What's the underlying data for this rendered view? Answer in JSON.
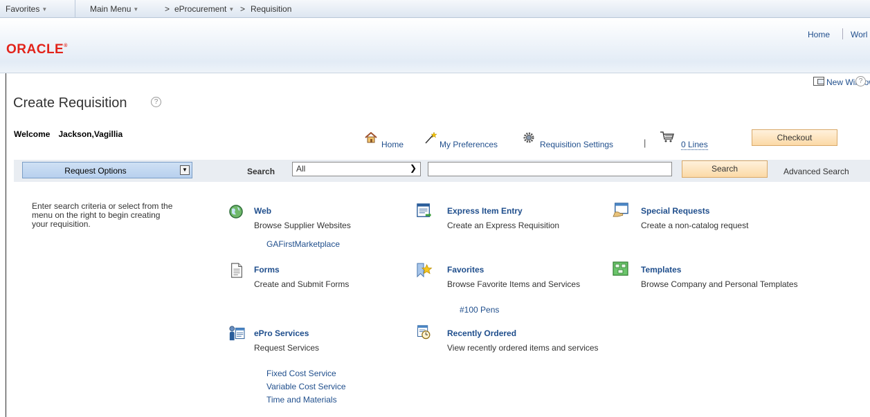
{
  "topnav": {
    "favorites": "Favorites",
    "main_menu": "Main Menu",
    "eprocurement": "eProcurement",
    "requisition": "Requisition",
    "breadcrumb_sep": ">"
  },
  "banner": {
    "logo": "ORACLE",
    "home": "Home",
    "worklist": "Worl"
  },
  "page": {
    "new_window": "New Window",
    "help": "?",
    "title": "Create Requisition",
    "welcome_label": "Welcome",
    "user_name": "Jackson,Vagillia"
  },
  "actions": {
    "home": "Home",
    "my_preferences": "My Preferences",
    "requisition_settings": "Requisition Settings",
    "pipe": "|",
    "lines": "0 Lines",
    "checkout": "Checkout"
  },
  "search": {
    "request_options": "Request Options",
    "label": "Search",
    "category_selected": "All",
    "input_value": "",
    "button": "Search",
    "advanced": "Advanced Search"
  },
  "instructions": "Enter search criteria or select from the menu on the right to begin creating your requisition.",
  "options": {
    "web": {
      "title": "Web",
      "desc": "Browse Supplier Websites",
      "links": [
        "GAFirstMarketplace"
      ]
    },
    "express": {
      "title": "Express Item Entry",
      "desc": "Create an Express Requisition"
    },
    "special": {
      "title": "Special Requests",
      "desc": "Create a non-catalog request"
    },
    "forms": {
      "title": "Forms",
      "desc": "Create and Submit Forms"
    },
    "favorites": {
      "title": "Favorites",
      "desc": "Browse Favorite Items and Services",
      "links": [
        "#100 Pens"
      ]
    },
    "templates": {
      "title": "Templates",
      "desc": "Browse Company and Personal Templates"
    },
    "epro": {
      "title": "ePro Services",
      "desc": "Request Services",
      "links": [
        "Fixed Cost Service",
        "Variable Cost Service",
        "Time and Materials"
      ]
    },
    "recent": {
      "title": "Recently Ordered",
      "desc": "View recently ordered items and services"
    }
  },
  "colors": {
    "link": "#1f4e8c",
    "oracle_red": "#e2231a",
    "button_orange": "#fbd9a6",
    "request_options_blue": "#b7d0ee"
  }
}
